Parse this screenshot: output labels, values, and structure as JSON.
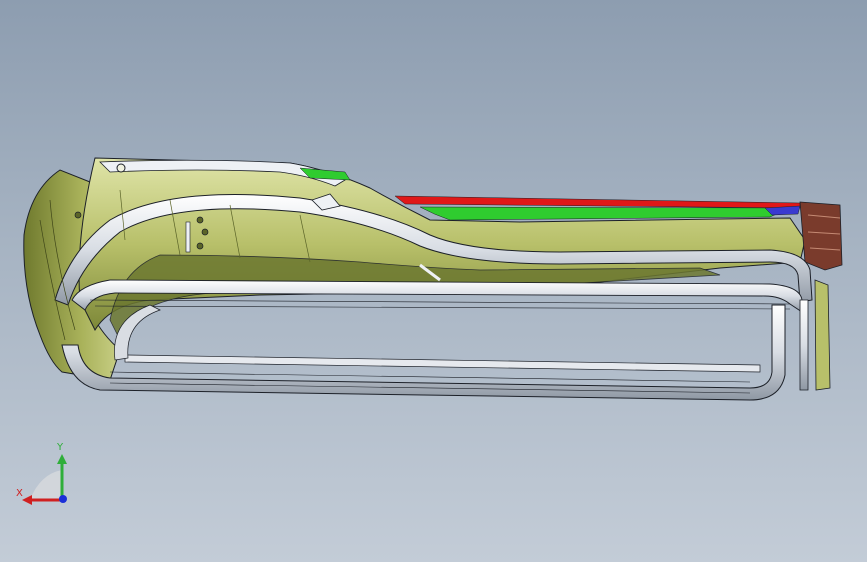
{
  "viewport": {
    "background_top": "#8d9db0",
    "background_bottom": "#c3ccd7"
  },
  "model": {
    "body_color": "#b8c06a",
    "shadow_color": "#6f7a2e",
    "highlight_color": "#e8ecc0",
    "tube_color": "#eef1f5",
    "edge_color": "#1c2028",
    "accent_green": "#2fcc2f",
    "accent_red": "#e01818",
    "accent_brown": "#7a3b2c"
  },
  "triad": {
    "x_label": "X",
    "y_label": "Y",
    "x_color": "#d02020",
    "y_color": "#2fae3a",
    "z_color": "#1a2fd8"
  }
}
